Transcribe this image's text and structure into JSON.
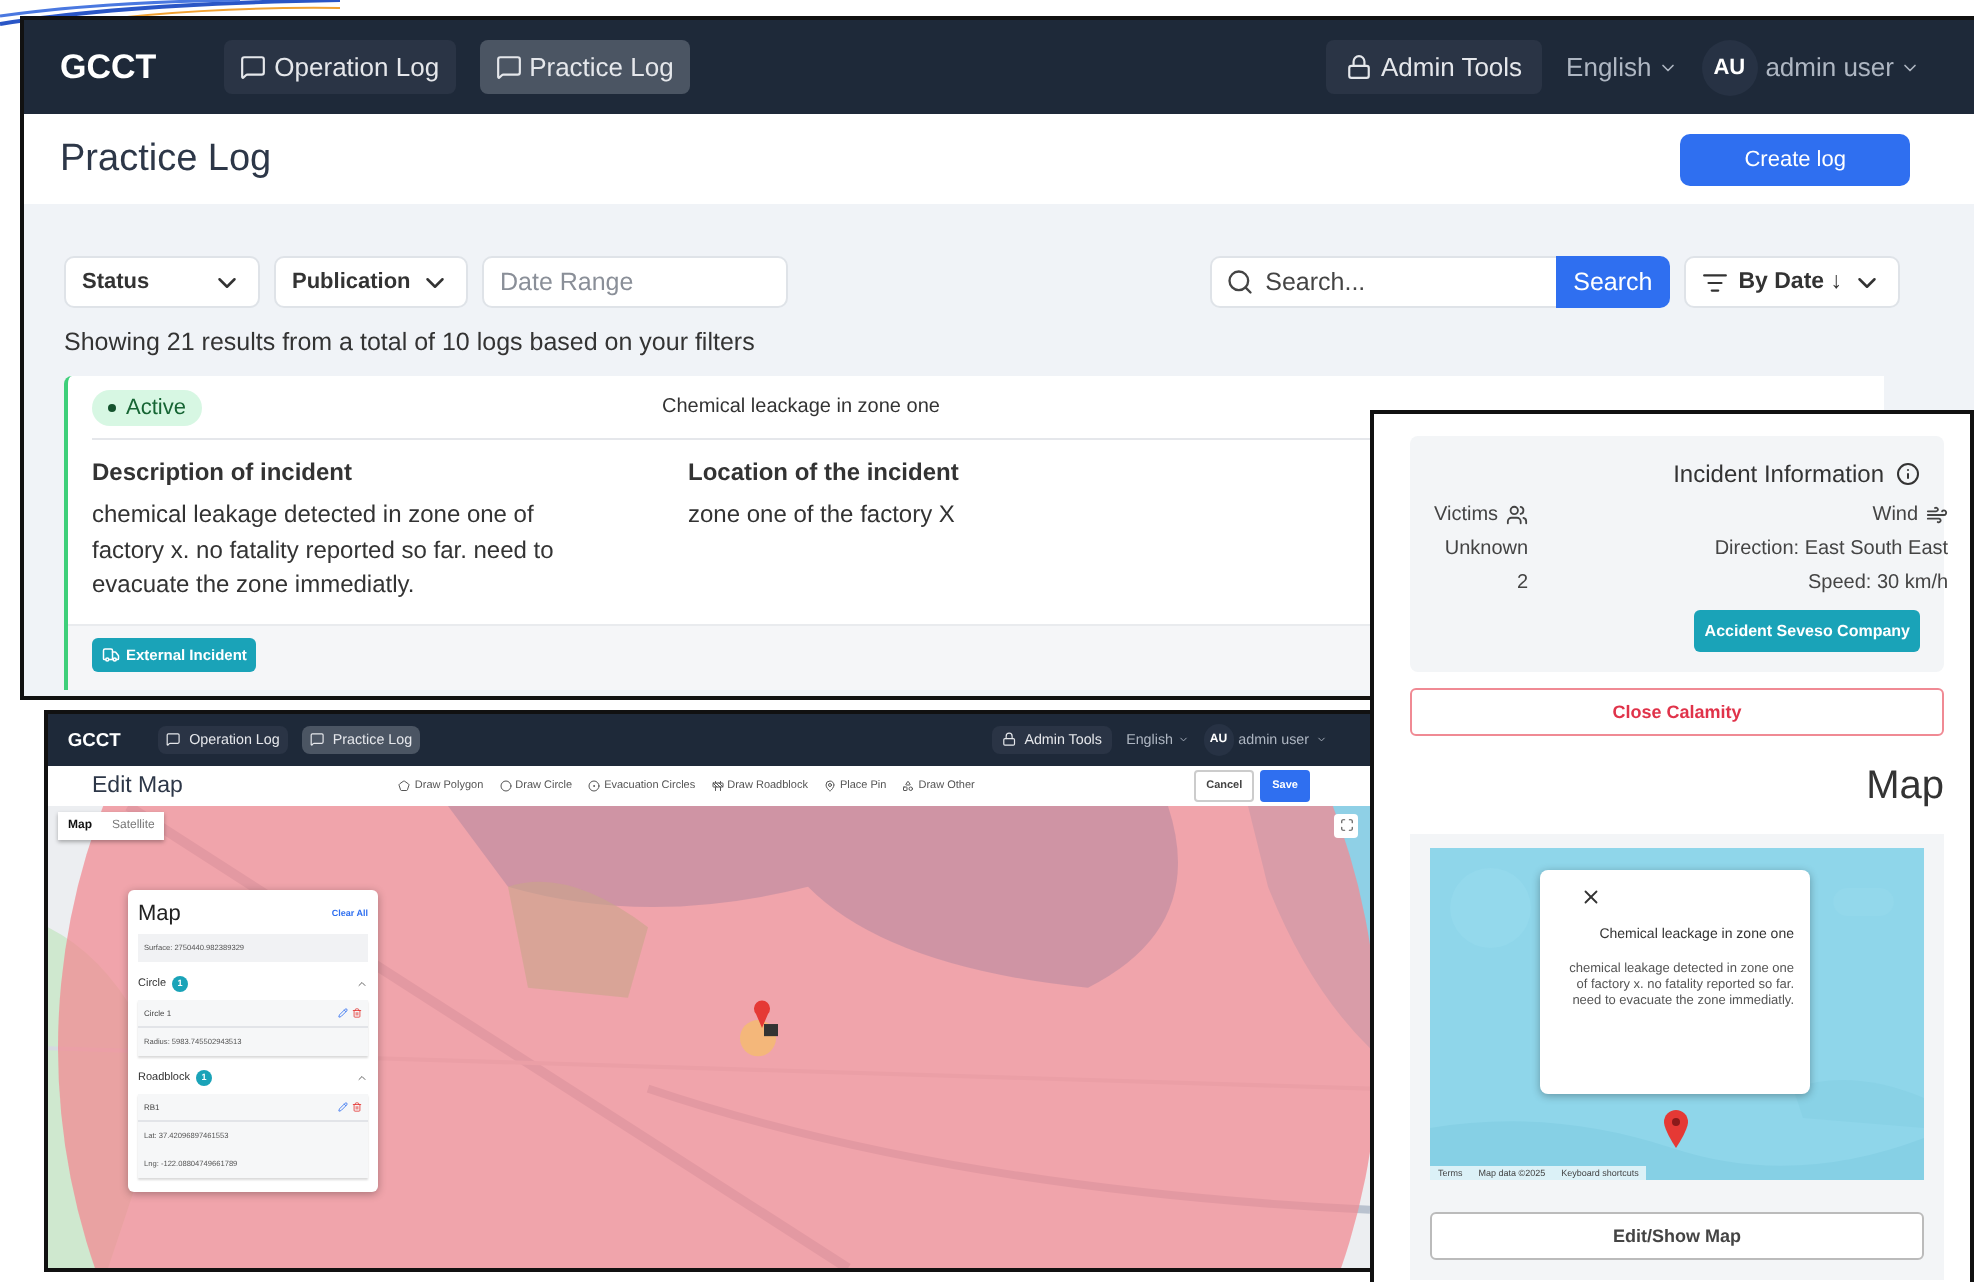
{
  "log_screen": {
    "navbar": {
      "brand": "GCCT",
      "nav": [
        {
          "label": "Operation Log",
          "selected": false
        },
        {
          "label": "Practice Log",
          "selected": true
        }
      ],
      "admin": "Admin Tools",
      "language": "English",
      "avatar": "AU",
      "user": "admin user"
    },
    "title": "Practice Log",
    "create_button": "Create log",
    "filters": [
      {
        "label": "Status"
      },
      {
        "label": "Publication"
      }
    ],
    "date_range": {
      "placeholder": "Date Range"
    },
    "search": {
      "placeholder": "Search..."
    },
    "search_button": "Search",
    "sort": "By Date ↓",
    "summary": "Showing 21 results from a total of 10 logs based on your filters",
    "card": {
      "status": "Active",
      "title": "Chemical leackage in zone one",
      "description_label": "Description of incident",
      "description": "chemical leakage detected in zone one of factory x. no fatality reported so far. need to evacuate the zone immediatly.",
      "location_label": "Location of the incident",
      "location": "zone one of the factory X",
      "tag": "External Incident"
    }
  },
  "map_editor_screen": {
    "navbar": {
      "brand": "GCCT",
      "nav": [
        {
          "label": "Operation Log",
          "selected": false
        },
        {
          "label": "Practice Log",
          "selected": true
        }
      ],
      "admin": "Admin Tools",
      "language": "English",
      "avatar": "AU",
      "user": "admin user"
    },
    "title": "Edit Map",
    "tools": [
      {
        "kind": "polygon",
        "label": "Draw Polygon"
      },
      {
        "kind": "circle",
        "label": "Draw Circle"
      },
      {
        "kind": "evacuation",
        "label": "Evacuation Circles"
      },
      {
        "kind": "roadblock",
        "label": "Draw Roadblock"
      },
      {
        "kind": "pin",
        "label": "Place Pin"
      },
      {
        "kind": "other",
        "label": "Draw Other"
      }
    ],
    "cancel_button": "Cancel",
    "save_button": "Save",
    "map_types": [
      {
        "label": "Map",
        "selected": true
      },
      {
        "label": "Satellite",
        "selected": false
      }
    ],
    "panel": {
      "title": "Map",
      "clear": "Clear All",
      "surface": "Surface: 2750440.982389329",
      "sections": [
        {
          "title": "Circle",
          "count": "1",
          "expanded": true,
          "items": [
            {
              "name": "Circle 1",
              "details": [
                "Radius: 5983.745502943513"
              ]
            }
          ]
        },
        {
          "title": "Roadblock",
          "count": "1",
          "expanded": true,
          "items": [
            {
              "name": "RB1",
              "details": [
                "Lat: 37.42096897461553",
                "Lng: -122.08804749661789"
              ]
            }
          ]
        }
      ]
    }
  },
  "incident_panel": {
    "heading": "Incident Information",
    "columns": [
      {
        "kind": "victims",
        "label": "Victims",
        "lines": [
          "Unknown",
          "2"
        ]
      },
      {
        "kind": "wind",
        "label": "Wind",
        "lines": [
          "Direction: East South East",
          "Speed: 30 km/h"
        ]
      }
    ],
    "company_button": "Accident Seveso Company",
    "close_button": "Close Calamity",
    "map_title": "Map",
    "popup": {
      "title": "Chemical leackage in zone one",
      "body": "chemical leakage detected in zone one of factory x. no fatality reported so far. need to evacuate the zone immediatly."
    },
    "attribution": [
      "Terms",
      "Map data ©2025",
      "Keyboard shortcuts"
    ],
    "edit_button": "Edit/Show Map"
  }
}
